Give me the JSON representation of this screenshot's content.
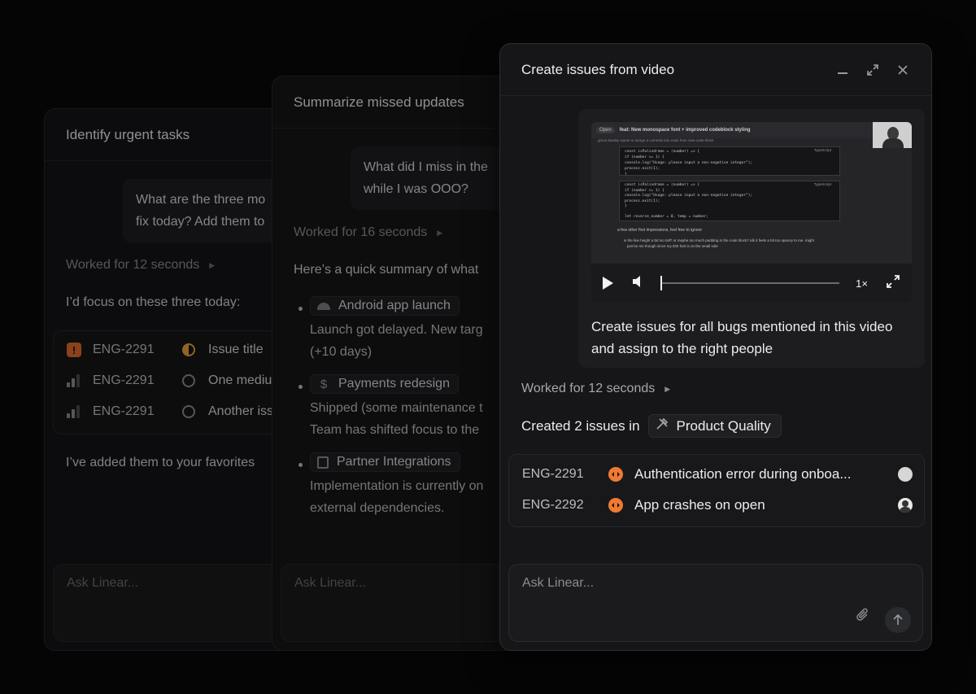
{
  "panel_left": {
    "title": "Identify urgent tasks",
    "user_message_line1": "What are the three mo",
    "user_message_line2": "fix today? Add them to",
    "worked": "Worked for 12 seconds",
    "intro": "I’d focus on these three today:",
    "issues": [
      {
        "id": "ENG-2291",
        "title": "Issue title",
        "priority": "urgent"
      },
      {
        "id": "ENG-2291",
        "title": "One mediu",
        "priority": "medium"
      },
      {
        "id": "ENG-2291",
        "title": "Another iss",
        "priority": "medium"
      }
    ],
    "footer": "I’ve added them to your favorites",
    "composer_placeholder": "Ask Linear..."
  },
  "panel_mid": {
    "title": "Summarize missed updates",
    "user_message_line1": "What did I miss in the",
    "user_message_line2": "while I was OOO?",
    "worked": "Worked for 16 seconds",
    "intro": "Here’s a quick summary of what",
    "items": [
      {
        "project": "Android app launch",
        "line1": "Launch got delayed. New targ",
        "line2": "(+10 days)",
        "icon": "android-icon"
      },
      {
        "project": "Payments redesign",
        "line1": "Shipped (some maintenance t",
        "line2": "Team has shifted focus to the",
        "icon": "dollar-icon"
      },
      {
        "project": "Partner Integrations",
        "line1": "Implementation is currently on",
        "line2": "external dependencies.",
        "icon": "building-icon"
      }
    ],
    "composer_placeholder": "Ask Linear..."
  },
  "panel_front": {
    "title": "Create issues from video",
    "video": {
      "pr_badge": "Open",
      "pr_title": "feat: New monospace font + improved codeblock styling",
      "pr_sub": "grace.baraby wants to merge 3 commits into  main  from  new-code-block",
      "code_block1": [
        "const isPalindrome = (number) => {",
        "  if (number <= 1) {",
        "    console.log(\"Usage: please input a non-negative integer\");",
        "    process.exit(1);",
        "  }"
      ],
      "code_block2": [
        "const isPalindrome = (number) => {",
        "  if (number <= 1) {",
        "    console.log(\"Usage: please input a non-negative integer\");",
        "    process.exit(1);",
        "  }",
        "",
        "  let reverse_number = 0, temp = number;"
      ],
      "lang_label": "TypeScript",
      "comment1": "a few other first impressions, feel free to ignore",
      "comment2": "is the line height a bit too tall? or maybe too much padding in the code block? idk it feels a bit too spacey to me. might",
      "comment3": "just be me though since my IDE font is on the small side",
      "speed": "1×"
    },
    "user_message_line1": "Create issues for all bugs mentioned in this video",
    "user_message_line2": "and assign to the right people",
    "worked": "Worked for 12 seconds",
    "created_prefix": "Created 2 issues in",
    "project_chip": "Product Quality",
    "issues": [
      {
        "id": "ENG-2291",
        "title": "Authentication error during onboa...",
        "status": "in-progress"
      },
      {
        "id": "ENG-2292",
        "title": "App crashes on open",
        "status": "in-progress"
      }
    ],
    "composer_placeholder": "Ask Linear..."
  },
  "colors": {
    "accent_orange": "#f07a32",
    "urgent_orange": "#e06a2b"
  }
}
